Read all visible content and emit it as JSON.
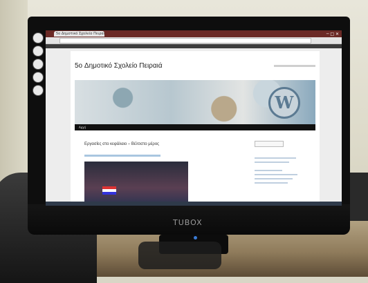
{
  "scene": {
    "monitor_brand": "TUBOX"
  },
  "screen": {
    "browser_tab": "5o Δημοτικό Σχολείο Πειραιά",
    "url": "",
    "page": {
      "site_title": "5o Δημοτικό Σχολείο Πειραιά",
      "nav_items": [
        "Αρχή",
        "",
        ""
      ],
      "post_title": "Εργασίες στο κεφάλαιο – Βέλτιστο μέρος",
      "video_caption": "",
      "sidebar_heading": ""
    }
  },
  "icons": {
    "dock": [
      "app-icon",
      "app-icon",
      "app-icon",
      "app-icon",
      "app-icon"
    ],
    "header_logo": "wordpress-logo-icon"
  },
  "colors": {
    "browser_chrome": "#6b2a26",
    "nav_bar": "#111111",
    "bezel": "#0e0e0e"
  }
}
